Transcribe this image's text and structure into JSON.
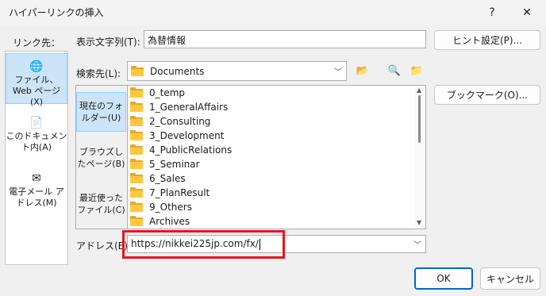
{
  "window": {
    "title": "ハイパーリンクの挿入",
    "help_label": "?",
    "close_label": "✕"
  },
  "link_to": {
    "label": "リンク先：",
    "items": [
      {
        "label": "ファイル、Web ページ(X)",
        "icon": "globe-file-icon",
        "selected": true
      },
      {
        "label": "このドキュメント内(A)",
        "icon": "document-icon",
        "selected": false
      },
      {
        "label": "電子メール アドレス(M)",
        "icon": "email-icon",
        "selected": false
      }
    ]
  },
  "display_text": {
    "label": "表示文字列(T):",
    "value": "為替情報"
  },
  "screentip_button": "ヒント設定(P)...",
  "look_in": {
    "label": "検索先(L):",
    "value": "Documents"
  },
  "browse": {
    "items": [
      {
        "label": "現在のフォルダー(U)",
        "selected": true
      },
      {
        "label": "ブラウズしたページ(B)",
        "selected": false
      },
      {
        "label": "最近使ったファイル(C)",
        "selected": false
      }
    ]
  },
  "files": [
    "0_temp",
    "1_GeneralAffairs",
    "2_Consulting",
    "3_Development",
    "4_PublicRelations",
    "5_Seminar",
    "6_Sales",
    "7_PlanResult",
    "9_Others",
    "Archives"
  ],
  "bookmark_button": "ブックマーク(O)...",
  "address": {
    "label": "アドレス(E):",
    "value": "https://nikkei225jp.com/fx/"
  },
  "ok_button": "OK",
  "cancel_button": "キャンセル",
  "colors": {
    "highlight": "#e8141e",
    "selection": "#cce4f7",
    "folder": "#ffc83d"
  }
}
